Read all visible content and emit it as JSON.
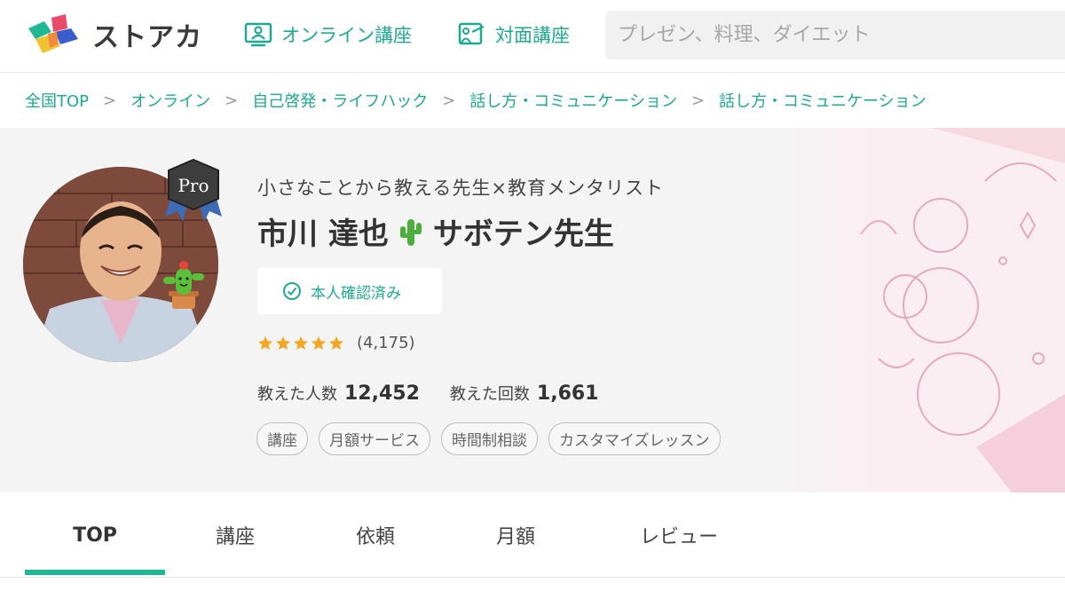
{
  "header": {
    "logo_text": "ストアカ",
    "nav": [
      {
        "label": "オンライン講座",
        "icon": "monitor-person-icon"
      },
      {
        "label": "対面講座",
        "icon": "whiteboard-icon"
      }
    ],
    "search_placeholder": "プレゼン、料理、ダイエット"
  },
  "breadcrumb": {
    "items": [
      "全国TOP",
      "オンライン",
      "自己啓発・ライフハック",
      "話し方・コミュニケーション",
      "話し方・コミュニケーション"
    ],
    "separator": ">"
  },
  "profile": {
    "tagline": "小さなことから教える先生×教育メンタリスト",
    "name_part1": "市川 達也",
    "name_part2": "サボテン先生",
    "badge_label": "Pro",
    "verified_label": "本人確認済み",
    "rating_stars": 5,
    "review_count": "(4,175)",
    "stats": {
      "students_label": "教えた人数",
      "students_value": "12,452",
      "sessions_label": "教えた回数",
      "sessions_value": "1,661"
    },
    "tags": [
      "講座",
      "月額サービス",
      "時間制相談",
      "カスタマイズレッスン"
    ]
  },
  "tabs": {
    "items": [
      "TOP",
      "講座",
      "依頼",
      "月額",
      "レビュー"
    ],
    "active": "TOP"
  },
  "colors": {
    "accent": "#1fa98f",
    "tab_indicator": "#1fb894",
    "star": "#f5a623"
  }
}
